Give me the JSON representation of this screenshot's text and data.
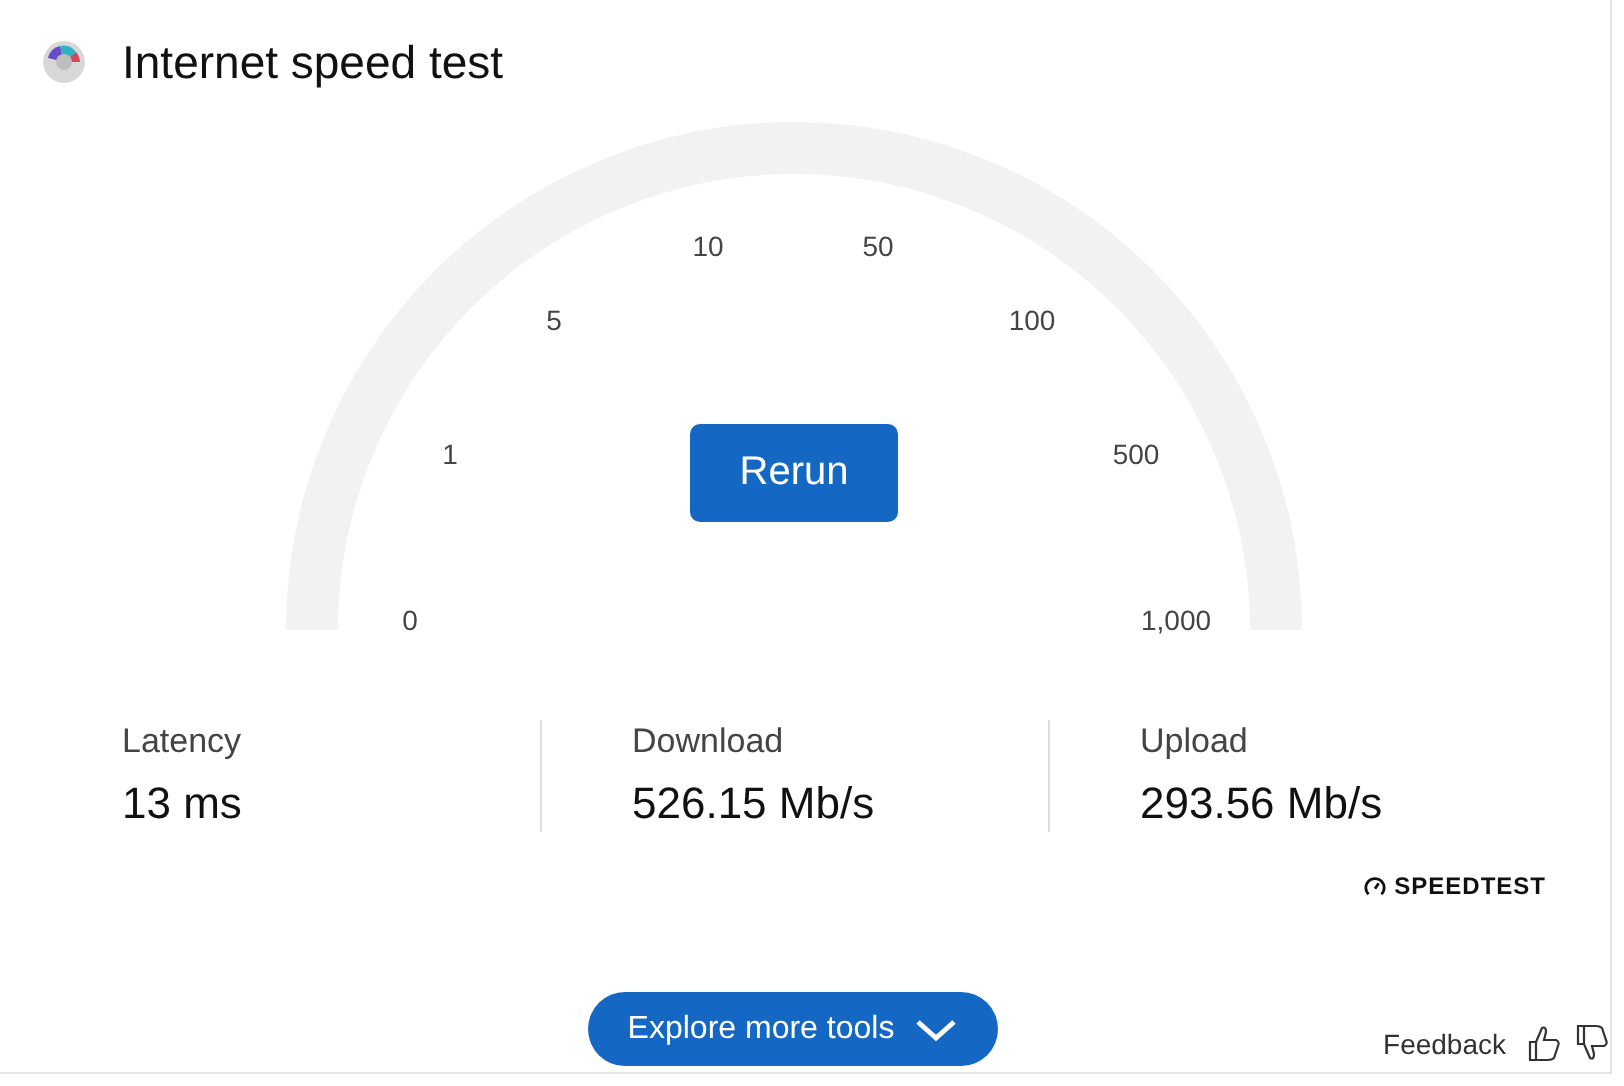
{
  "title": "Internet speed test",
  "gauge": {
    "ticks": [
      "0",
      "1",
      "5",
      "10",
      "50",
      "100",
      "500",
      "1,000"
    ]
  },
  "rerun_button": "Rerun",
  "stats": [
    {
      "label": "Latency",
      "value": "13 ms"
    },
    {
      "label": "Download",
      "value": "526.15 Mb/s"
    },
    {
      "label": "Upload",
      "value": "293.56 Mb/s"
    }
  ],
  "provider": "SPEEDTEST",
  "explore_button": "Explore more tools",
  "feedback": "Feedback"
}
